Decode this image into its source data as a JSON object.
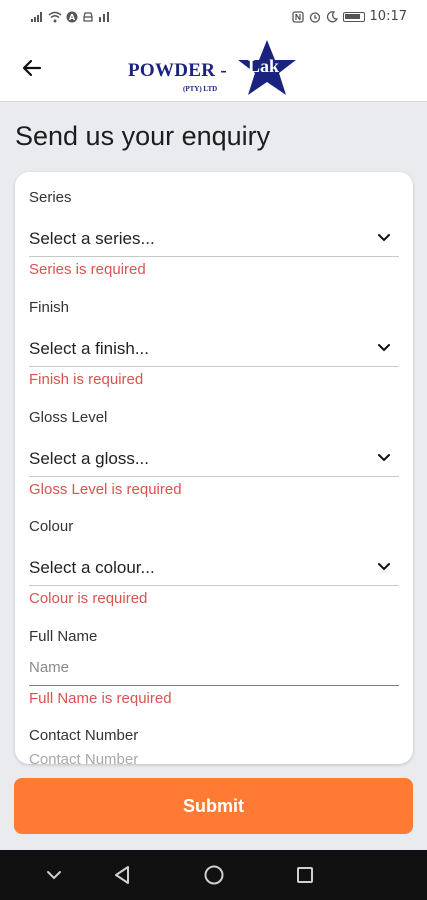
{
  "status_bar": {
    "left_icons": [
      "signal-icon",
      "wifi-icon",
      "notification-a-icon",
      "car-icon",
      "bar-chart-icon"
    ],
    "right_icons": [
      "nfc-icon",
      "alarm-icon",
      "moon-icon",
      "battery-icon"
    ],
    "time": "10:17"
  },
  "header": {
    "logo_text": "POWDER - ",
    "logo_star_text": "Lak",
    "logo_sub": "(PTY) LTD",
    "brand_color": "#1a237e"
  },
  "page_title": "Send us your enquiry",
  "form": {
    "series": {
      "label": "Series",
      "placeholder": "Select a series...",
      "error": "Series is required"
    },
    "finish": {
      "label": "Finish",
      "placeholder": "Select a finish...",
      "error": "Finish is required"
    },
    "gloss": {
      "label": "Gloss Level",
      "placeholder": "Select a gloss...",
      "error": "Gloss Level is required"
    },
    "colour": {
      "label": "Colour",
      "placeholder": "Select a colour...",
      "error": "Colour is required"
    },
    "full_name": {
      "label": "Full Name",
      "placeholder": "Name",
      "error": "Full Name is required"
    },
    "contact_number": {
      "label": "Contact Number",
      "placeholder": "Contact Number"
    }
  },
  "submit_label": "Submit",
  "colors": {
    "accent": "#ff7b33",
    "error": "#d9534f",
    "background": "#e9ebee"
  },
  "nav_bar": {
    "buttons": [
      "chevron-down-icon",
      "back-triangle-icon",
      "home-circle-icon",
      "recents-square-icon"
    ]
  }
}
